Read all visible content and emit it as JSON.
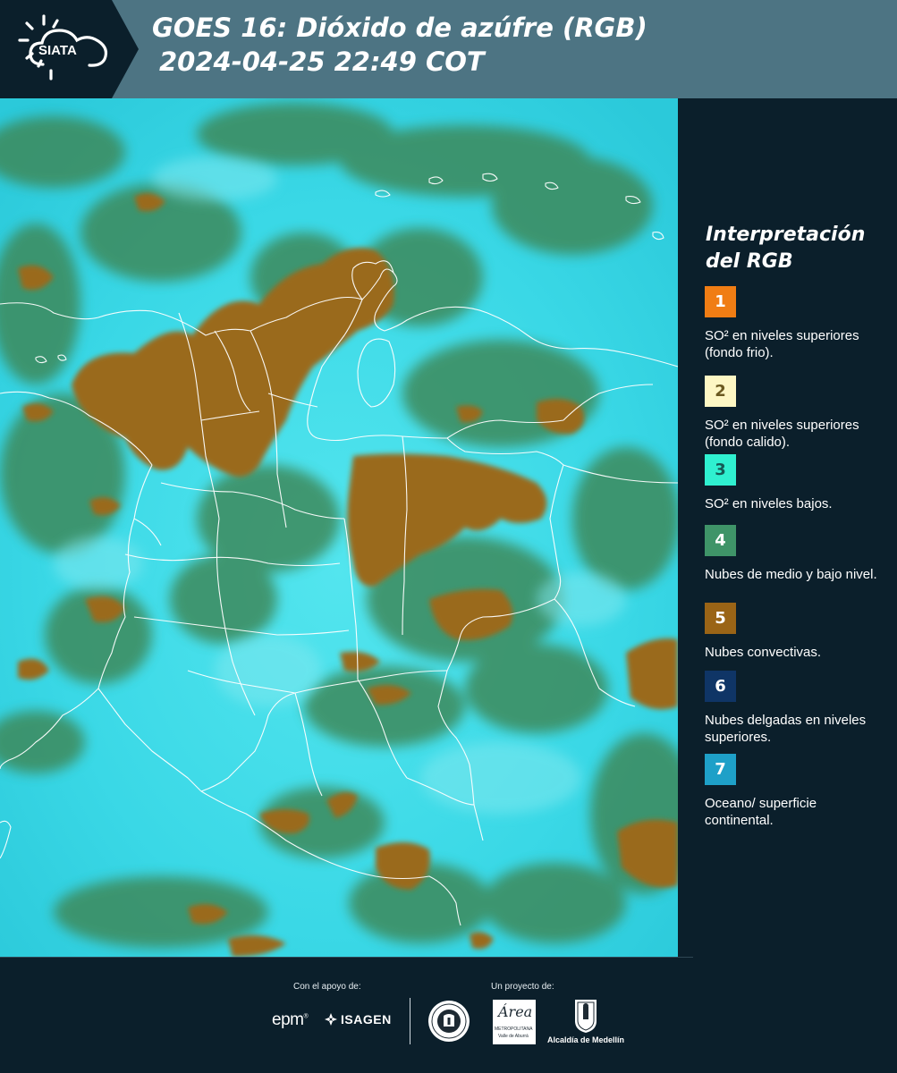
{
  "header": {
    "logo_text": "SIATA",
    "title_line1": "GOES 16: Dióxido de azúfre (RGB)",
    "title_line2": "2024-04-25 22:49 COT"
  },
  "legend": {
    "title": "Interpretación del RGB",
    "items": [
      {
        "number": "1",
        "label": "SO² en niveles superiores (fondo frio).",
        "color": "#f07d14",
        "text_color": "#ffffff"
      },
      {
        "number": "2",
        "label": "SO² en niveles superiores (fondo calido).",
        "color": "#fdf7c4",
        "text_color": "#6b5a20"
      },
      {
        "number": "3",
        "label": "SO² en niveles bajos.",
        "color": "#2ff0d0",
        "text_color": "#155a55"
      },
      {
        "number": "4",
        "label": "Nubes de medio y bajo nivel.",
        "color": "#3f9468",
        "text_color": "#ffffff"
      },
      {
        "number": "5",
        "label": "Nubes convectivas.",
        "color": "#9a6416",
        "text_color": "#ffffff"
      },
      {
        "number": "6",
        "label": "Nubes delgadas en niveles superiores.",
        "color": "#0f3566",
        "text_color": "#ffffff"
      },
      {
        "number": "7",
        "label": "Oceano/ superficie continental.",
        "color": "#1ea0c8",
        "text_color": "#ffffff"
      }
    ]
  },
  "footer": {
    "support_label": "Con el apoyo de:",
    "project_label": "Un proyecto de:",
    "epm": "epm",
    "isagen": "ISAGEN",
    "amva_script": "Área",
    "amva_line1": "METROPOLITANA",
    "amva_line2": "Valle de Aburrá",
    "alcaldia": "Alcaldía de Medellín"
  },
  "colors": {
    "header_bar": "#4d7483",
    "logo_block": "#0b1f2b",
    "background": "#0b1f2b",
    "map_cyan": "#34d7e6",
    "map_green": "#3d8a5c",
    "map_brown": "#9a6a1c"
  }
}
